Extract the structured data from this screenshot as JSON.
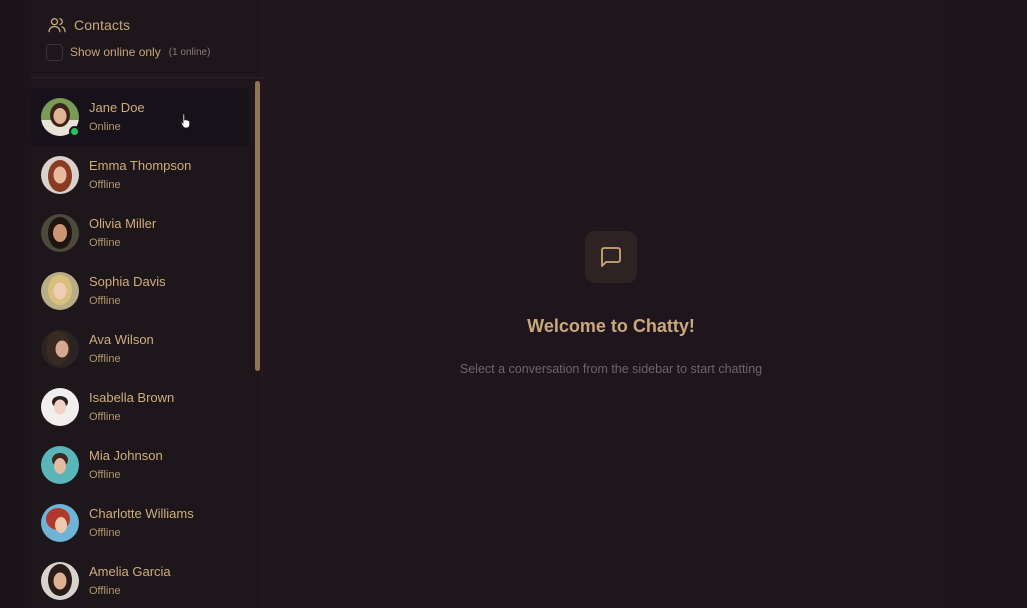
{
  "sidebar": {
    "title": "Contacts",
    "title_icon": "users-icon",
    "filter": {
      "label": "Show online only",
      "checked": false,
      "count": "(1 online)"
    },
    "contacts": [
      {
        "name": "Jane Doe",
        "status": "Online",
        "online": true,
        "selected": true
      },
      {
        "name": "Emma Thompson",
        "status": "Offline",
        "online": false
      },
      {
        "name": "Olivia Miller",
        "status": "Offline",
        "online": false
      },
      {
        "name": "Sophia Davis",
        "status": "Offline",
        "online": false
      },
      {
        "name": "Ava Wilson",
        "status": "Offline",
        "online": false
      },
      {
        "name": "Isabella Brown",
        "status": "Offline",
        "online": false
      },
      {
        "name": "Mia Johnson",
        "status": "Offline",
        "online": false
      },
      {
        "name": "Charlotte Williams",
        "status": "Offline",
        "online": false
      },
      {
        "name": "Amelia Garcia",
        "status": "Offline",
        "online": false
      }
    ]
  },
  "main": {
    "icon": "message-square-icon",
    "title": "Welcome to Chatty!",
    "subtitle": "Select a conversation from the sidebar to start chatting"
  },
  "colors": {
    "background": "#1e161c",
    "accent": "#c9a778",
    "online": "#22c55e",
    "scrollbar": "#8f7552"
  }
}
